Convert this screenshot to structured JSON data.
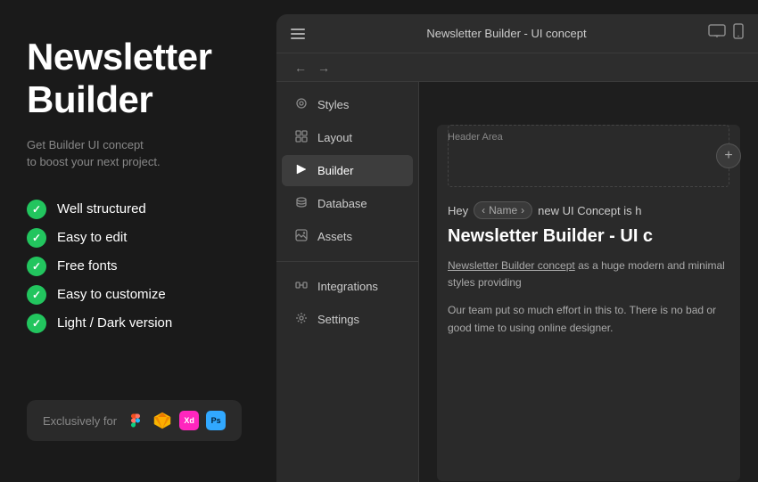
{
  "left": {
    "title_line1": "Newsletter",
    "title_line2": "Builder",
    "subtitle_line1": "Get Builder UI concept",
    "subtitle_line2": "to boost your next project.",
    "features": [
      {
        "id": "well-structured",
        "label": "Well structured"
      },
      {
        "id": "easy-edit",
        "label": "Easy to edit"
      },
      {
        "id": "free-fonts",
        "label": "Free fonts"
      },
      {
        "id": "easy-customize",
        "label": "Easy to customize"
      },
      {
        "id": "light-dark",
        "label": "Light / Dark version"
      }
    ],
    "exclusively_label": "Exclusively for"
  },
  "app": {
    "titlebar": {
      "title": "Newsletter Builder - UI concept",
      "hamburger_label": "menu",
      "back_label": "←",
      "forward_label": "→",
      "desktop_icon": "🖥",
      "mobile_icon": "📱"
    },
    "sidebar": {
      "items": [
        {
          "id": "styles",
          "label": "Styles",
          "icon": "◈"
        },
        {
          "id": "layout",
          "label": "Layout",
          "icon": "⊞"
        },
        {
          "id": "builder",
          "label": "Builder",
          "icon": "▷",
          "active": true
        },
        {
          "id": "database",
          "label": "Database",
          "icon": "⚙"
        },
        {
          "id": "assets",
          "label": "Assets",
          "icon": "🖼"
        },
        {
          "id": "integrations",
          "label": "Integrations",
          "icon": "⬡"
        },
        {
          "id": "settings",
          "label": "Settings",
          "icon": "⚙"
        }
      ]
    },
    "canvas": {
      "header_area_label": "Header Area",
      "greeting": "Hey",
      "name_tag": "Name",
      "name_tag_prefix": "‹",
      "name_tag_suffix": "›",
      "greeting_suffix": "new UI Concept is h",
      "email_heading": "Newsletter Builder - UI c",
      "body_paragraph1_link": "Newsletter Builder concept",
      "body_paragraph1_rest": " as a huge modern and minimal styles providing",
      "body_paragraph2": "Our team put so much effort in this to. There is no bad or good time to using online designer."
    }
  }
}
